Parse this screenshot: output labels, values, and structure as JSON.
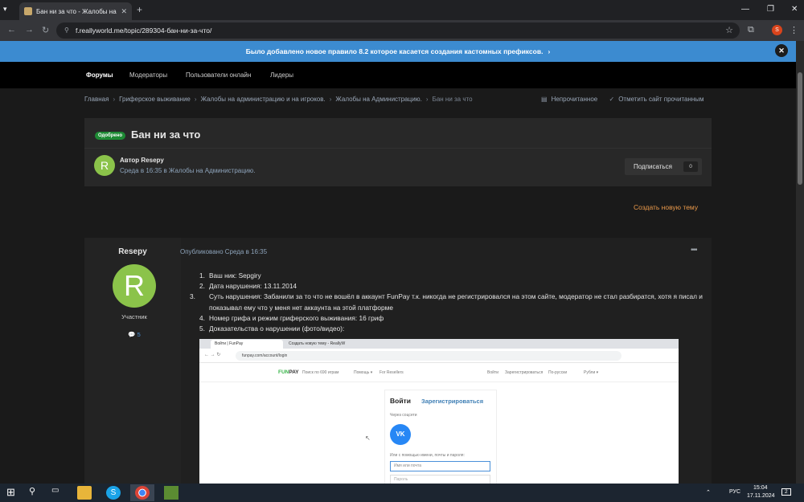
{
  "browser": {
    "tab_title": "Бан ни за что - Жалобы на Ад",
    "tab_close": "✕",
    "new_tab": "+",
    "url": "f.reallyworld.me/topic/289304-бан-ни-за-что/",
    "profile_initial": "S"
  },
  "announcement": {
    "text": "Было добавлено новое правило 8.2 которое касается создания кастомных префиксов.",
    "chevron": "›",
    "close": "✕"
  },
  "main_nav": [
    "Форумы",
    "Модераторы",
    "Пользователи онлайн",
    "Лидеры"
  ],
  "breadcrumb": [
    "Главная",
    "Гриферское выживание",
    "Жалобы на администрацию и на игроков.",
    "Жалобы на Администрацию.",
    "Бан ни за что"
  ],
  "breadcrumb_actions": {
    "unread": "Непрочитанное",
    "mark_read": "Отметить сайт прочитанным"
  },
  "topic": {
    "badge": "Одобрено",
    "title": "Бан ни за что",
    "author_initial": "R",
    "author_line": "Автор Resepy",
    "meta_line": "Среда в 16:35 в Жалобы на Администрацию.",
    "subscribe_label": "Подписаться",
    "subscribe_count": "0"
  },
  "create_topic": "Создать новую тему",
  "post": {
    "author": "Resepy",
    "avatar_initial": "R",
    "role": "Участник",
    "post_count": "5",
    "published": "Опубликовано Среда в 16:35",
    "menu": "•••",
    "items": [
      {
        "num": "1.",
        "text": "Ваш ник: Sepgiry"
      },
      {
        "num": "2.",
        "text": "Дата нарушения: 13.11.2014"
      },
      {
        "num": "3.",
        "text": "Суть нарушения: Забанили за то что не вошёл в аккаунт FunPay т.к. никогда не регистрировался на этом сайте, модератор не стал разбиратся, хотя я писал и показывал ему что у меня нет аккаунта на этой платформе"
      },
      {
        "num": "4.",
        "text": "Номер грифа и режим гриферского выживания: 16 гриф"
      },
      {
        "num": "5.",
        "text": "Доказательства о нарушении (фото/видео):"
      }
    ]
  },
  "embedded_screenshot": {
    "tab1": "Войти | FunPay",
    "tab2": "Создать новую тему - ReallyW",
    "url": "funpay.com/account/login",
    "logo_a": "FUN",
    "logo_b": "PAY",
    "search": "Поиск по 690 играм",
    "help": "Помощь ▾",
    "sellers": "For Resellers",
    "login_link": "Войти",
    "register_link": "Зарегистрироваться",
    "currency": "По-русски",
    "rub": "Рубли ▾",
    "tab_login": "Войти",
    "tab_register": "Зарегистрироваться",
    "via_social": "Через соцсети",
    "vk": "VK",
    "or_email": "Или с помощью имени, почты и пароля:",
    "email_placeholder": "Имя или почта",
    "password_placeholder": "Пароль"
  },
  "taskbar": {
    "lang": "РУС",
    "time": "15:04",
    "date": "17.11.2024",
    "notifications": "2"
  }
}
